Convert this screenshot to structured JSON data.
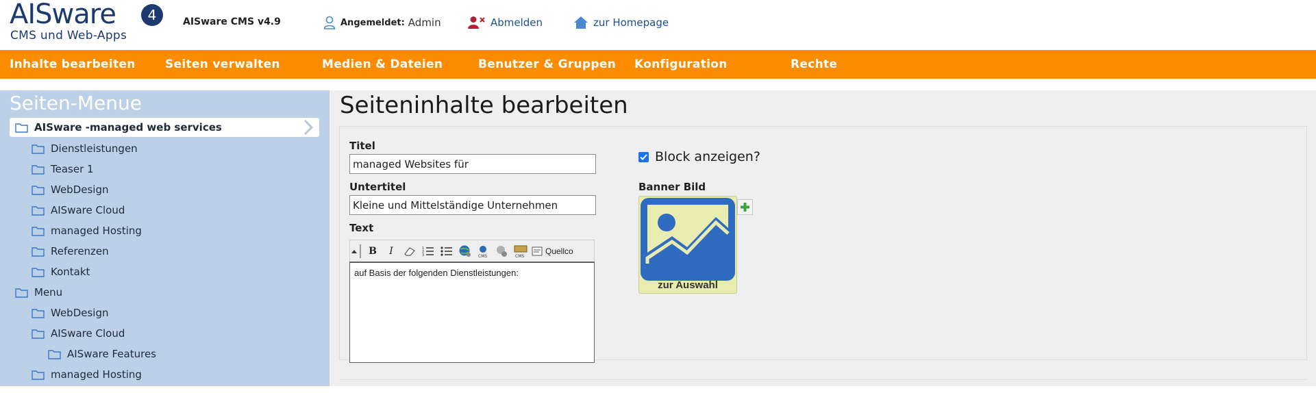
{
  "header": {
    "logo_brand": "AISware",
    "logo_badge": "4",
    "logo_sub": "CMS und Web-Apps",
    "version": "AISware CMS v4.9",
    "logged_in_label": "Angemeldet:",
    "logged_in_user": "Admin",
    "logout": "Abmelden",
    "homepage": "zur Homepage"
  },
  "nav": {
    "items": [
      {
        "label": "Inhalte bearbeiten"
      },
      {
        "label": "Seiten verwalten"
      },
      {
        "label": "Medien & Dateien"
      },
      {
        "label": "Benutzer & Gruppen"
      },
      {
        "label": "Konfiguration"
      },
      {
        "label": "Rechte"
      }
    ]
  },
  "sidebar": {
    "title": "Seiten-Menue",
    "items": [
      {
        "label": "AISware -managed web services",
        "level": 0,
        "active": true
      },
      {
        "label": "Dienstleistungen",
        "level": 1
      },
      {
        "label": "Teaser 1",
        "level": 1
      },
      {
        "label": "WebDesign",
        "level": 1
      },
      {
        "label": "AISware Cloud",
        "level": 1
      },
      {
        "label": "managed Hosting",
        "level": 1
      },
      {
        "label": "Referenzen",
        "level": 1
      },
      {
        "label": "Kontakt",
        "level": 1
      },
      {
        "label": "Menu",
        "level": 0
      },
      {
        "label": "WebDesign",
        "level": 1
      },
      {
        "label": "AISware Cloud",
        "level": 1
      },
      {
        "label": "AISware Features",
        "level": 2
      },
      {
        "label": "managed Hosting",
        "level": 1
      }
    ]
  },
  "main": {
    "page_title": "Seiteninhalte bearbeiten",
    "title_label": "Titel",
    "title_value": "managed Websites für",
    "subtitle_label": "Untertitel",
    "subtitle_value": "Kleine und Mittelständige Unternehmen",
    "text_label": "Text",
    "toolbar_source": "Quellco",
    "editor_content": "auf Basis der folgenden Dienstleistungen:",
    "show_block_label": "Block anzeigen?",
    "show_block_checked": true,
    "banner_label": "Banner Bild",
    "banner_caption": "zur Auswahl"
  },
  "colors": {
    "accent": "#fb8c00",
    "sidebar_bg": "#bcd0e8",
    "link": "#1d4f8c",
    "logout_icon": "#b22234"
  }
}
